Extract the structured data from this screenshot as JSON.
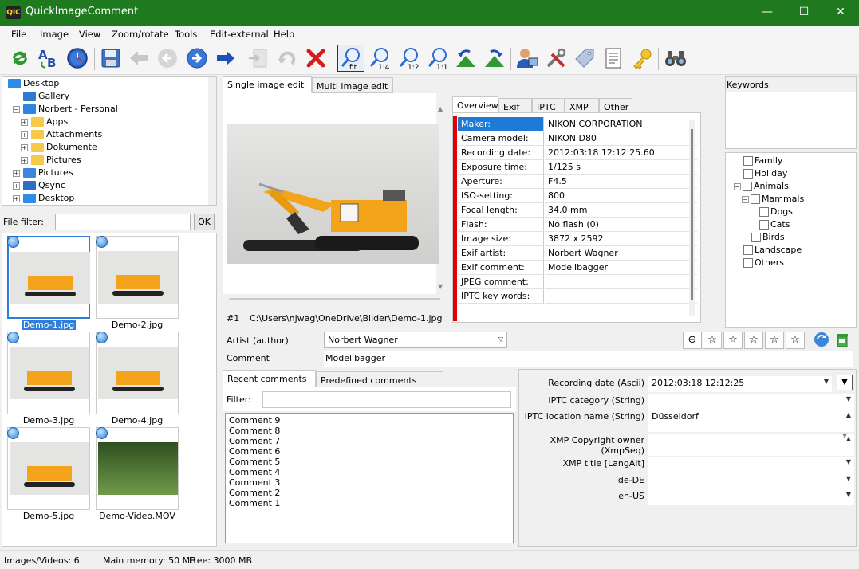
{
  "window": {
    "title": "QuickImageComment",
    "app_icon": "QIC",
    "controls": [
      "—",
      "☐",
      "✕"
    ]
  },
  "menu": [
    "File",
    "Image",
    "View",
    "Zoom/rotate",
    "Tools",
    "Edit-external",
    "Help"
  ],
  "toolbar": {
    "zoom_labels": [
      "fit",
      "1:4",
      "1:2",
      "1:1"
    ]
  },
  "folder_tree": [
    {
      "label": "Desktop",
      "level": 0,
      "icon": "desktop-icon"
    },
    {
      "label": "Gallery",
      "level": 1,
      "icon": "gallery-icon"
    },
    {
      "label": "Norbert - Personal",
      "level": 1,
      "icon": "cloud-icon"
    },
    {
      "label": "Apps",
      "level": 2,
      "icon": "folder-icon"
    },
    {
      "label": "Attachments",
      "level": 2,
      "icon": "folder-icon"
    },
    {
      "label": "Dokumente",
      "level": 2,
      "icon": "folder-icon"
    },
    {
      "label": "Pictures",
      "level": 2,
      "icon": "folder-icon"
    },
    {
      "label": "Pictures",
      "level": 1,
      "icon": "pictures-icon"
    },
    {
      "label": "Qsync",
      "level": 1,
      "icon": "qsync-icon"
    },
    {
      "label": "Desktop",
      "level": 1,
      "icon": "desktop-icon"
    }
  ],
  "file_filter": {
    "label": "File filter:",
    "value": "",
    "ok": "OK"
  },
  "thumbnails": [
    {
      "name": "Demo-1.jpg",
      "selected": true
    },
    {
      "name": "Demo-2.jpg",
      "selected": false
    },
    {
      "name": "Demo-3.jpg",
      "selected": false
    },
    {
      "name": "Demo-4.jpg",
      "selected": false
    },
    {
      "name": "Demo-5.jpg",
      "selected": false
    },
    {
      "name": "Demo-Video.MOV",
      "selected": false
    }
  ],
  "edit_tabs": {
    "single": "Single image edit",
    "multi": "Multi image edit"
  },
  "image_info": {
    "index": "#1",
    "path": "C:\\Users\\njwag\\OneDrive\\Bilder\\Demo-1.jpg"
  },
  "meta_tabs": [
    "Overview",
    "Exif",
    "IPTC",
    "XMP",
    "Other"
  ],
  "overview": [
    {
      "k": "Maker:",
      "v": "NIKON CORPORATION"
    },
    {
      "k": "Camera model:",
      "v": "NIKON D80"
    },
    {
      "k": "Recording date:",
      "v": "2012:03:18 12:12:25.60"
    },
    {
      "k": "Exposure time:",
      "v": "1/125 s"
    },
    {
      "k": "Aperture:",
      "v": "F4.5"
    },
    {
      "k": "ISO-setting:",
      "v": "800"
    },
    {
      "k": "Focal length:",
      "v": "34.0 mm"
    },
    {
      "k": "Flash:",
      "v": "No flash (0)"
    },
    {
      "k": "Image size:",
      "v": "3872 x 2592"
    },
    {
      "k": "Exif artist:",
      "v": "Norbert Wagner"
    },
    {
      "k": "Exif comment:",
      "v": "Modellbagger"
    },
    {
      "k": "JPEG comment:",
      "v": ""
    },
    {
      "k": "IPTC key words:",
      "v": ""
    }
  ],
  "keywords": {
    "title": "Keywords"
  },
  "keyword_tree": [
    {
      "label": "Family",
      "level": 0
    },
    {
      "label": "Holiday",
      "level": 0
    },
    {
      "label": "Animals",
      "level": 0
    },
    {
      "label": "Mammals",
      "level": 1
    },
    {
      "label": "Dogs",
      "level": 2
    },
    {
      "label": "Cats",
      "level": 2
    },
    {
      "label": "Birds",
      "level": 1
    },
    {
      "label": "Landscape",
      "level": 0
    },
    {
      "label": "Others",
      "level": 0
    }
  ],
  "artist": {
    "label": "Artist (author)",
    "value": "Norbert Wagner"
  },
  "comment": {
    "label": "Comment",
    "value": "Modellbagger"
  },
  "rating": {
    "min": "⊖",
    "stars": [
      "☆",
      "☆",
      "☆",
      "☆",
      "☆"
    ]
  },
  "comment_tabs": {
    "recent": "Recent comments",
    "predefined": "Predefined comments"
  },
  "comment_filter": {
    "label": "Filter:",
    "value": ""
  },
  "recent_comments": [
    "Comment 9",
    "Comment 8",
    "Comment 7",
    "Comment 6",
    "Comment 5",
    "Comment 4",
    "Comment 3",
    "Comment 2",
    "Comment 1"
  ],
  "meta_fields": [
    {
      "label": "Recording date (Ascii)",
      "value": "2012:03:18 12:12:25"
    },
    {
      "label": "IPTC category (String)",
      "value": ""
    },
    {
      "label": "IPTC location name (String)",
      "value": "Düsseldorf"
    },
    {
      "label": "XMP Copyright owner (XmpSeq)",
      "value": ""
    },
    {
      "label": "XMP title [LangAlt]",
      "value": ""
    },
    {
      "label": "de-DE",
      "value": ""
    },
    {
      "label": "en-US",
      "value": ""
    }
  ],
  "status": {
    "count": "Images/Videos: 6",
    "memory": "Main memory: 50 MB",
    "free": "Free: 3000 MB"
  }
}
